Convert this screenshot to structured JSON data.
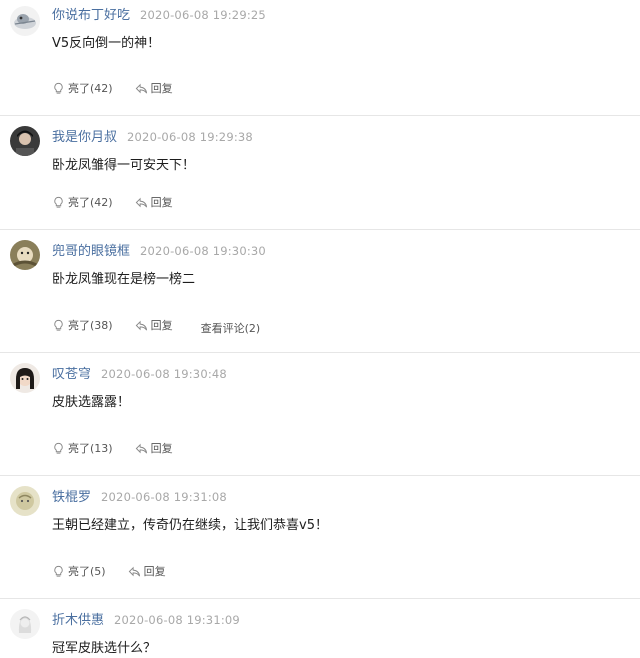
{
  "comments": [
    {
      "username": "你说布丁好吃",
      "time": "2020-06-08 19:29:25",
      "text": "V5反向倒一的神！",
      "like_label": "亮了(42)",
      "reply_label": "回复"
    },
    {
      "username": "我是你月叔",
      "time": "2020-06-08 19:29:38",
      "text": "卧龙凤雏得一可安天下！",
      "like_label": "亮了(42)",
      "reply_label": "回复"
    },
    {
      "username": "兜哥的眼镜框",
      "time": "2020-06-08 19:30:30",
      "text": "卧龙凤雏现在是榜一榜二",
      "like_label": "亮了(38)",
      "reply_label": "回复",
      "view_replies": "查看评论(2)"
    },
    {
      "username": "叹苍穹",
      "time": "2020-06-08 19:30:48",
      "text": "皮肤选露露！",
      "like_label": "亮了(13)",
      "reply_label": "回复"
    },
    {
      "username": "铁棍罗",
      "time": "2020-06-08 19:31:08",
      "text": "王朝已经建立，传奇仍在继续，让我们恭喜v5！",
      "like_label": "亮了(5)",
      "reply_label": "回复"
    },
    {
      "username": "折木供惠",
      "time": "2020-06-08 19:31:09",
      "text": "冠军皮肤选什么？"
    }
  ],
  "icons": {
    "like": "lightbulb-icon",
    "reply": "reply-arrow-icon"
  },
  "colors": {
    "username": "#4a6fa0",
    "timestamp": "#a8a8a8",
    "divider": "#e6e6e6"
  }
}
